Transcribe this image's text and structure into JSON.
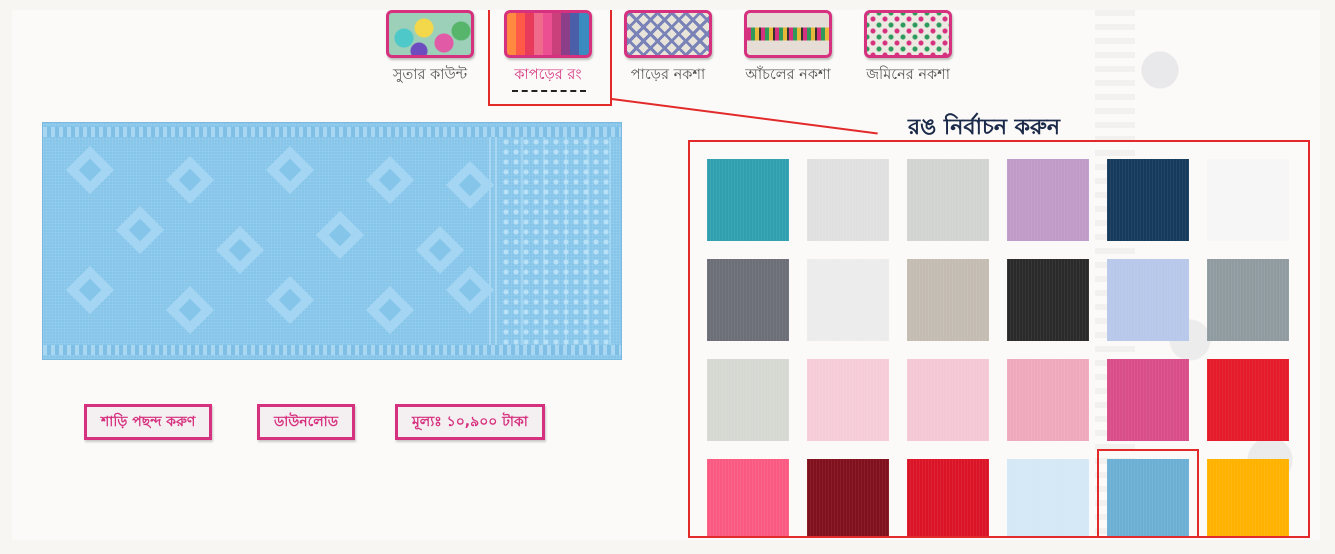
{
  "tabs": [
    {
      "label": "সুতার কাউন্ট",
      "thumb": "yarn",
      "icon": "yarn-thumbnail-icon",
      "active": false
    },
    {
      "label": "কাপড়ের রং",
      "thumb": "fabric",
      "icon": "fabric-colors-thumbnail-icon",
      "active": true
    },
    {
      "label": "পাড়ের নকশা",
      "thumb": "border",
      "icon": "border-design-thumbnail-icon",
      "active": false
    },
    {
      "label": "আঁচলের নকশা",
      "thumb": "anchal",
      "icon": "anchal-design-thumbnail-icon",
      "active": false
    },
    {
      "label": "জমিনের নকশা",
      "thumb": "jamin",
      "icon": "jamin-design-thumbnail-icon",
      "active": false
    }
  ],
  "picker": {
    "title": "রঙ নির্বাচন করুন",
    "swatches": [
      [
        "#30a0b0",
        "#e0e0e0",
        "#d2d4d2",
        "#c09ac8",
        "#153a5c",
        "#f6f6f6"
      ],
      [
        "#6c6f78",
        "#ececec",
        "#c4bcb2",
        "#2a2a2a",
        "#b7c8ea",
        "#8f9ba0"
      ],
      [
        "#d6d9d2",
        "#f6ccd8",
        "#f4c8d4",
        "#eeaabc",
        "#d94d88",
        "#e51a2a"
      ],
      [
        "#fa5a82",
        "#80101c",
        "#dc1428",
        "#d4e8f6",
        "#6cafd4",
        "#ffb300"
      ]
    ],
    "selected": [
      3,
      4
    ]
  },
  "buttons": {
    "select_saree": "শাড়ি পছন্দ করুণ",
    "download": "ডাউনলোড",
    "price": "মূল্যঃ ১০,৯০০ টাকা"
  },
  "colorbar": [
    "#ff77c8",
    "#1fc585",
    "#fdc10c",
    "#c8175d",
    "#b02fb5",
    "#f84512"
  ],
  "accent": "#d6317f",
  "saree_color": "#86c5ea"
}
